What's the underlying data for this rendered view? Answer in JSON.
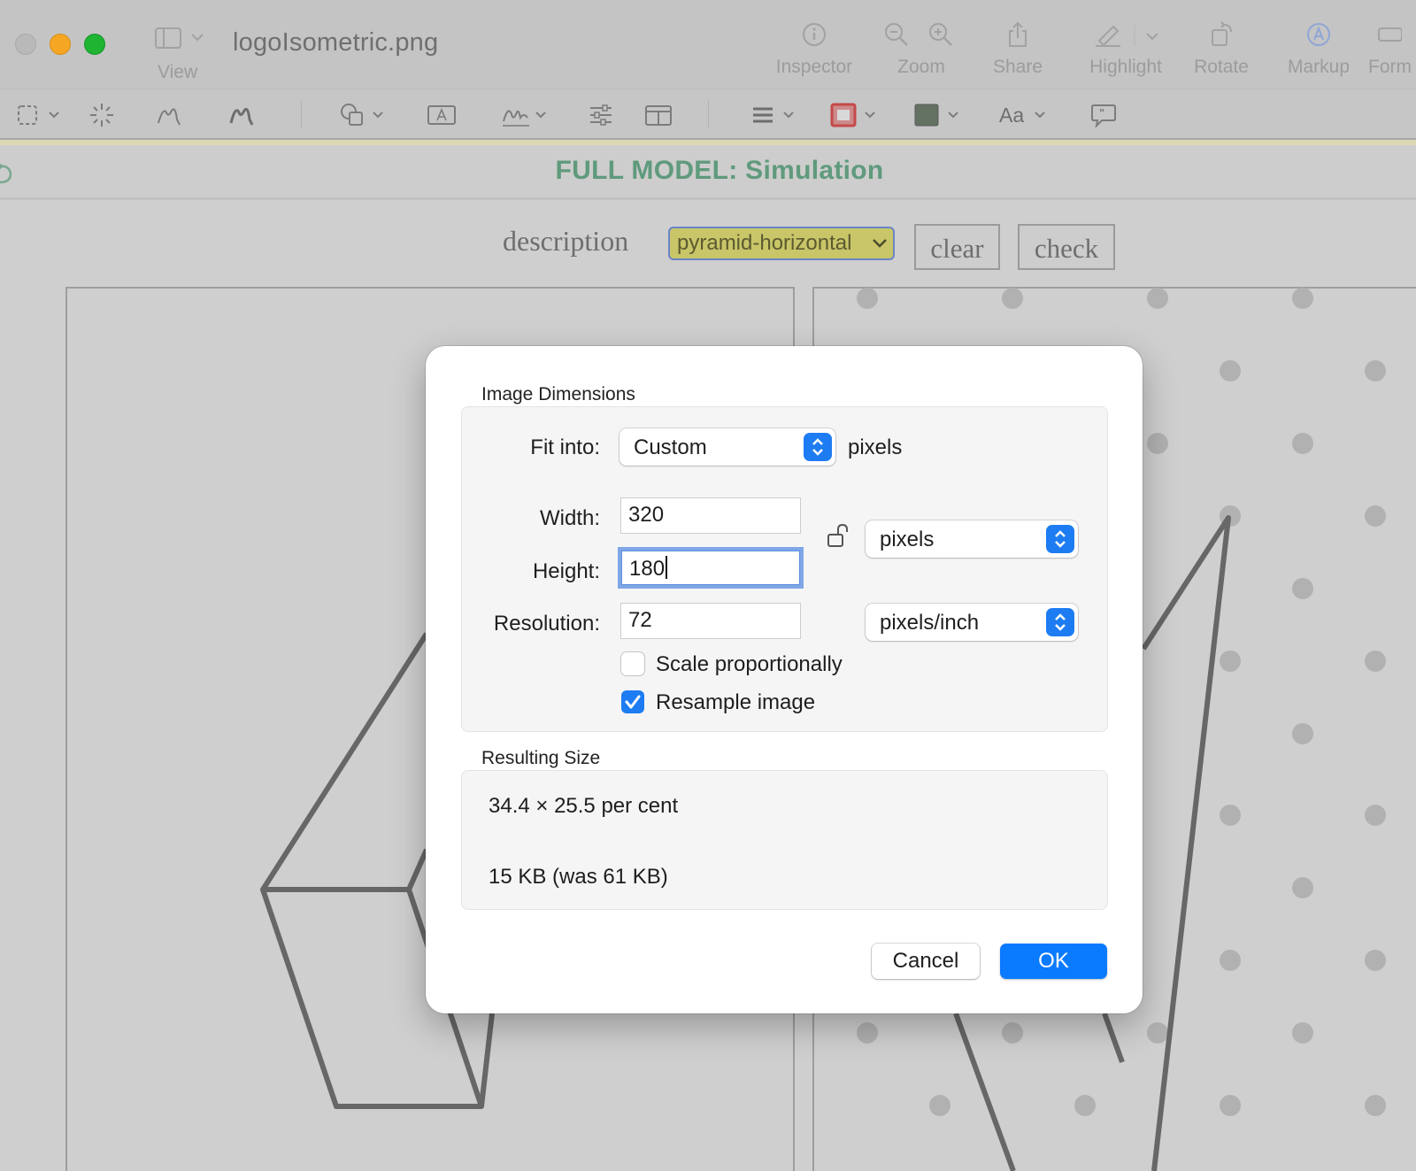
{
  "window": {
    "doc_title": "logoIsometric.png",
    "toolbar": {
      "view": "View",
      "inspector": "Inspector",
      "zoom": "Zoom",
      "share": "Share",
      "highlight": "Highlight",
      "rotate": "Rotate",
      "markup": "Markup",
      "form": "Form"
    }
  },
  "page": {
    "title": "FULL MODEL: Simulation",
    "description_label": "description",
    "description_value": "pyramid-horizontal",
    "clear_label": "clear",
    "check_label": "check"
  },
  "dialog": {
    "image_dimensions_title": "Image Dimensions",
    "fit_into_label": "Fit into:",
    "fit_into_value": "Custom",
    "fit_into_unit": "pixels",
    "width_label": "Width:",
    "width_value": "320",
    "height_label": "Height:",
    "height_value": "180",
    "size_unit_value": "pixels",
    "resolution_label": "Resolution:",
    "resolution_value": "72",
    "resolution_unit_value": "pixels/inch",
    "scale_proportionally_label": "Scale proportionally",
    "scale_proportionally_checked": false,
    "resample_image_label": "Resample image",
    "resample_image_checked": true,
    "resulting_size_title": "Resulting Size",
    "result_percent": "34.4 × 25.5 per cent",
    "result_filesize": "15 KB (was 61 KB)",
    "cancel_label": "Cancel",
    "ok_label": "OK"
  },
  "colors": {
    "accent": "#0a7aff",
    "sim_title": "#5f9a7c",
    "select_bg": "#c8c668",
    "close_light": "#b9b9b9",
    "minimize_light": "#f5a623",
    "zoom_light": "#1fb532"
  },
  "icons": [
    "sidebar-icon",
    "info-icon",
    "zoom-out-icon",
    "zoom-in-icon",
    "share-icon",
    "highlighter-icon",
    "rotate-icon",
    "markup-icon",
    "lock-open-icon",
    "checkmark-icon"
  ]
}
